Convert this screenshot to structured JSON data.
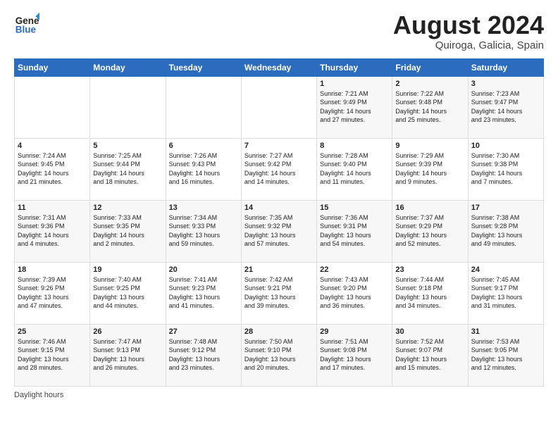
{
  "header": {
    "logo_line1": "General",
    "logo_line2": "Blue",
    "month_title": "August 2024",
    "subtitle": "Quiroga, Galicia, Spain"
  },
  "days_of_week": [
    "Sunday",
    "Monday",
    "Tuesday",
    "Wednesday",
    "Thursday",
    "Friday",
    "Saturday"
  ],
  "weeks": [
    [
      {
        "day": "",
        "info": ""
      },
      {
        "day": "",
        "info": ""
      },
      {
        "day": "",
        "info": ""
      },
      {
        "day": "",
        "info": ""
      },
      {
        "day": "1",
        "info": "Sunrise: 7:21 AM\nSunset: 9:49 PM\nDaylight: 14 hours\nand 27 minutes."
      },
      {
        "day": "2",
        "info": "Sunrise: 7:22 AM\nSunset: 9:48 PM\nDaylight: 14 hours\nand 25 minutes."
      },
      {
        "day": "3",
        "info": "Sunrise: 7:23 AM\nSunset: 9:47 PM\nDaylight: 14 hours\nand 23 minutes."
      }
    ],
    [
      {
        "day": "4",
        "info": "Sunrise: 7:24 AM\nSunset: 9:45 PM\nDaylight: 14 hours\nand 21 minutes."
      },
      {
        "day": "5",
        "info": "Sunrise: 7:25 AM\nSunset: 9:44 PM\nDaylight: 14 hours\nand 18 minutes."
      },
      {
        "day": "6",
        "info": "Sunrise: 7:26 AM\nSunset: 9:43 PM\nDaylight: 14 hours\nand 16 minutes."
      },
      {
        "day": "7",
        "info": "Sunrise: 7:27 AM\nSunset: 9:42 PM\nDaylight: 14 hours\nand 14 minutes."
      },
      {
        "day": "8",
        "info": "Sunrise: 7:28 AM\nSunset: 9:40 PM\nDaylight: 14 hours\nand 11 minutes."
      },
      {
        "day": "9",
        "info": "Sunrise: 7:29 AM\nSunset: 9:39 PM\nDaylight: 14 hours\nand 9 minutes."
      },
      {
        "day": "10",
        "info": "Sunrise: 7:30 AM\nSunset: 9:38 PM\nDaylight: 14 hours\nand 7 minutes."
      }
    ],
    [
      {
        "day": "11",
        "info": "Sunrise: 7:31 AM\nSunset: 9:36 PM\nDaylight: 14 hours\nand 4 minutes."
      },
      {
        "day": "12",
        "info": "Sunrise: 7:33 AM\nSunset: 9:35 PM\nDaylight: 14 hours\nand 2 minutes."
      },
      {
        "day": "13",
        "info": "Sunrise: 7:34 AM\nSunset: 9:33 PM\nDaylight: 13 hours\nand 59 minutes."
      },
      {
        "day": "14",
        "info": "Sunrise: 7:35 AM\nSunset: 9:32 PM\nDaylight: 13 hours\nand 57 minutes."
      },
      {
        "day": "15",
        "info": "Sunrise: 7:36 AM\nSunset: 9:31 PM\nDaylight: 13 hours\nand 54 minutes."
      },
      {
        "day": "16",
        "info": "Sunrise: 7:37 AM\nSunset: 9:29 PM\nDaylight: 13 hours\nand 52 minutes."
      },
      {
        "day": "17",
        "info": "Sunrise: 7:38 AM\nSunset: 9:28 PM\nDaylight: 13 hours\nand 49 minutes."
      }
    ],
    [
      {
        "day": "18",
        "info": "Sunrise: 7:39 AM\nSunset: 9:26 PM\nDaylight: 13 hours\nand 47 minutes."
      },
      {
        "day": "19",
        "info": "Sunrise: 7:40 AM\nSunset: 9:25 PM\nDaylight: 13 hours\nand 44 minutes."
      },
      {
        "day": "20",
        "info": "Sunrise: 7:41 AM\nSunset: 9:23 PM\nDaylight: 13 hours\nand 41 minutes."
      },
      {
        "day": "21",
        "info": "Sunrise: 7:42 AM\nSunset: 9:21 PM\nDaylight: 13 hours\nand 39 minutes."
      },
      {
        "day": "22",
        "info": "Sunrise: 7:43 AM\nSunset: 9:20 PM\nDaylight: 13 hours\nand 36 minutes."
      },
      {
        "day": "23",
        "info": "Sunrise: 7:44 AM\nSunset: 9:18 PM\nDaylight: 13 hours\nand 34 minutes."
      },
      {
        "day": "24",
        "info": "Sunrise: 7:45 AM\nSunset: 9:17 PM\nDaylight: 13 hours\nand 31 minutes."
      }
    ],
    [
      {
        "day": "25",
        "info": "Sunrise: 7:46 AM\nSunset: 9:15 PM\nDaylight: 13 hours\nand 28 minutes."
      },
      {
        "day": "26",
        "info": "Sunrise: 7:47 AM\nSunset: 9:13 PM\nDaylight: 13 hours\nand 26 minutes."
      },
      {
        "day": "27",
        "info": "Sunrise: 7:48 AM\nSunset: 9:12 PM\nDaylight: 13 hours\nand 23 minutes."
      },
      {
        "day": "28",
        "info": "Sunrise: 7:50 AM\nSunset: 9:10 PM\nDaylight: 13 hours\nand 20 minutes."
      },
      {
        "day": "29",
        "info": "Sunrise: 7:51 AM\nSunset: 9:08 PM\nDaylight: 13 hours\nand 17 minutes."
      },
      {
        "day": "30",
        "info": "Sunrise: 7:52 AM\nSunset: 9:07 PM\nDaylight: 13 hours\nand 15 minutes."
      },
      {
        "day": "31",
        "info": "Sunrise: 7:53 AM\nSunset: 9:05 PM\nDaylight: 13 hours\nand 12 minutes."
      }
    ]
  ],
  "footer": {
    "note": "Daylight hours"
  }
}
